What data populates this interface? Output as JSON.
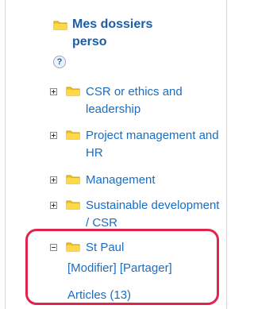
{
  "root": {
    "title": "Mes dossiers perso",
    "help": "?"
  },
  "items": [
    {
      "label": "CSR or ethics and leadership"
    },
    {
      "label": "Project management and HR"
    },
    {
      "label": "Management"
    },
    {
      "label": "Sustainable development / CSR"
    }
  ],
  "selected": {
    "label": "St Paul",
    "modify": "[Modifier]",
    "share": "[Partager]",
    "articles_label": "Articles",
    "articles_count": "(13)"
  },
  "colors": {
    "link": "#1a6dc2",
    "folder": "#f2c11b",
    "highlight": "#e0244e"
  }
}
